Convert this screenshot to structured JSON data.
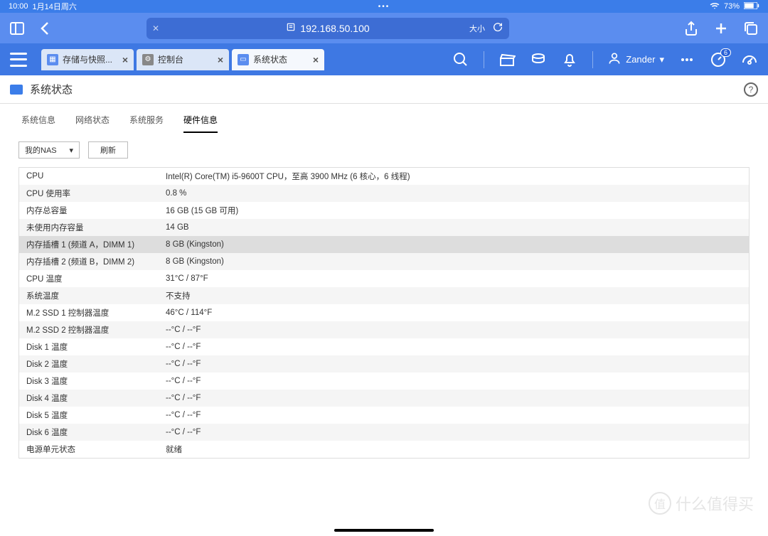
{
  "status_bar": {
    "time": "10:00",
    "date": "1月14日周六",
    "battery": "73%"
  },
  "browser": {
    "url": "192.168.50.100",
    "size_label": "大小"
  },
  "app_tabs": [
    {
      "label": "存储与快照..."
    },
    {
      "label": "控制台"
    },
    {
      "label": "系统状态"
    }
  ],
  "user": {
    "name": "Zander"
  },
  "notification_badge": "6",
  "page": {
    "title": "系统状态"
  },
  "sub_tabs": [
    "系统信息",
    "网络状态",
    "系统服务",
    "硬件信息"
  ],
  "controls": {
    "select": "我的NAS",
    "refresh": "刷新"
  },
  "rows": [
    {
      "label": "CPU",
      "value": "Intel(R) Core(TM) i5-9600T CPU，至高 3900 MHz (6 核心，6 线程)"
    },
    {
      "label": "CPU 使用率",
      "value": "0.8 %"
    },
    {
      "label": "内存总容量",
      "value": "16 GB (15 GB 可用)"
    },
    {
      "label": "未使用内存容量",
      "value": "14 GB"
    },
    {
      "label": "内存插槽 1 (频道 A，DIMM 1)",
      "value": "8 GB (Kingston)",
      "hl": true
    },
    {
      "label": "内存插槽 2 (频道 B，DIMM 2)",
      "value": "8 GB (Kingston)"
    },
    {
      "label": "CPU 温度",
      "value": "31°C / 87°F"
    },
    {
      "label": "系统温度",
      "value": "不支持"
    },
    {
      "label": "M.2 SSD 1 控制器温度",
      "value": "46°C / 114°F"
    },
    {
      "label": "M.2 SSD 2 控制器温度",
      "value": "--°C / --°F"
    },
    {
      "label": "Disk 1 温度",
      "value": "--°C / --°F"
    },
    {
      "label": "Disk 2 温度",
      "value": "--°C / --°F"
    },
    {
      "label": "Disk 3 温度",
      "value": "--°C / --°F"
    },
    {
      "label": "Disk 4 温度",
      "value": "--°C / --°F"
    },
    {
      "label": "Disk 5 温度",
      "value": "--°C / --°F"
    },
    {
      "label": "Disk 6 温度",
      "value": "--°C / --°F"
    },
    {
      "label": "电源单元状态",
      "value": "就绪"
    }
  ],
  "watermark": "什么值得买"
}
